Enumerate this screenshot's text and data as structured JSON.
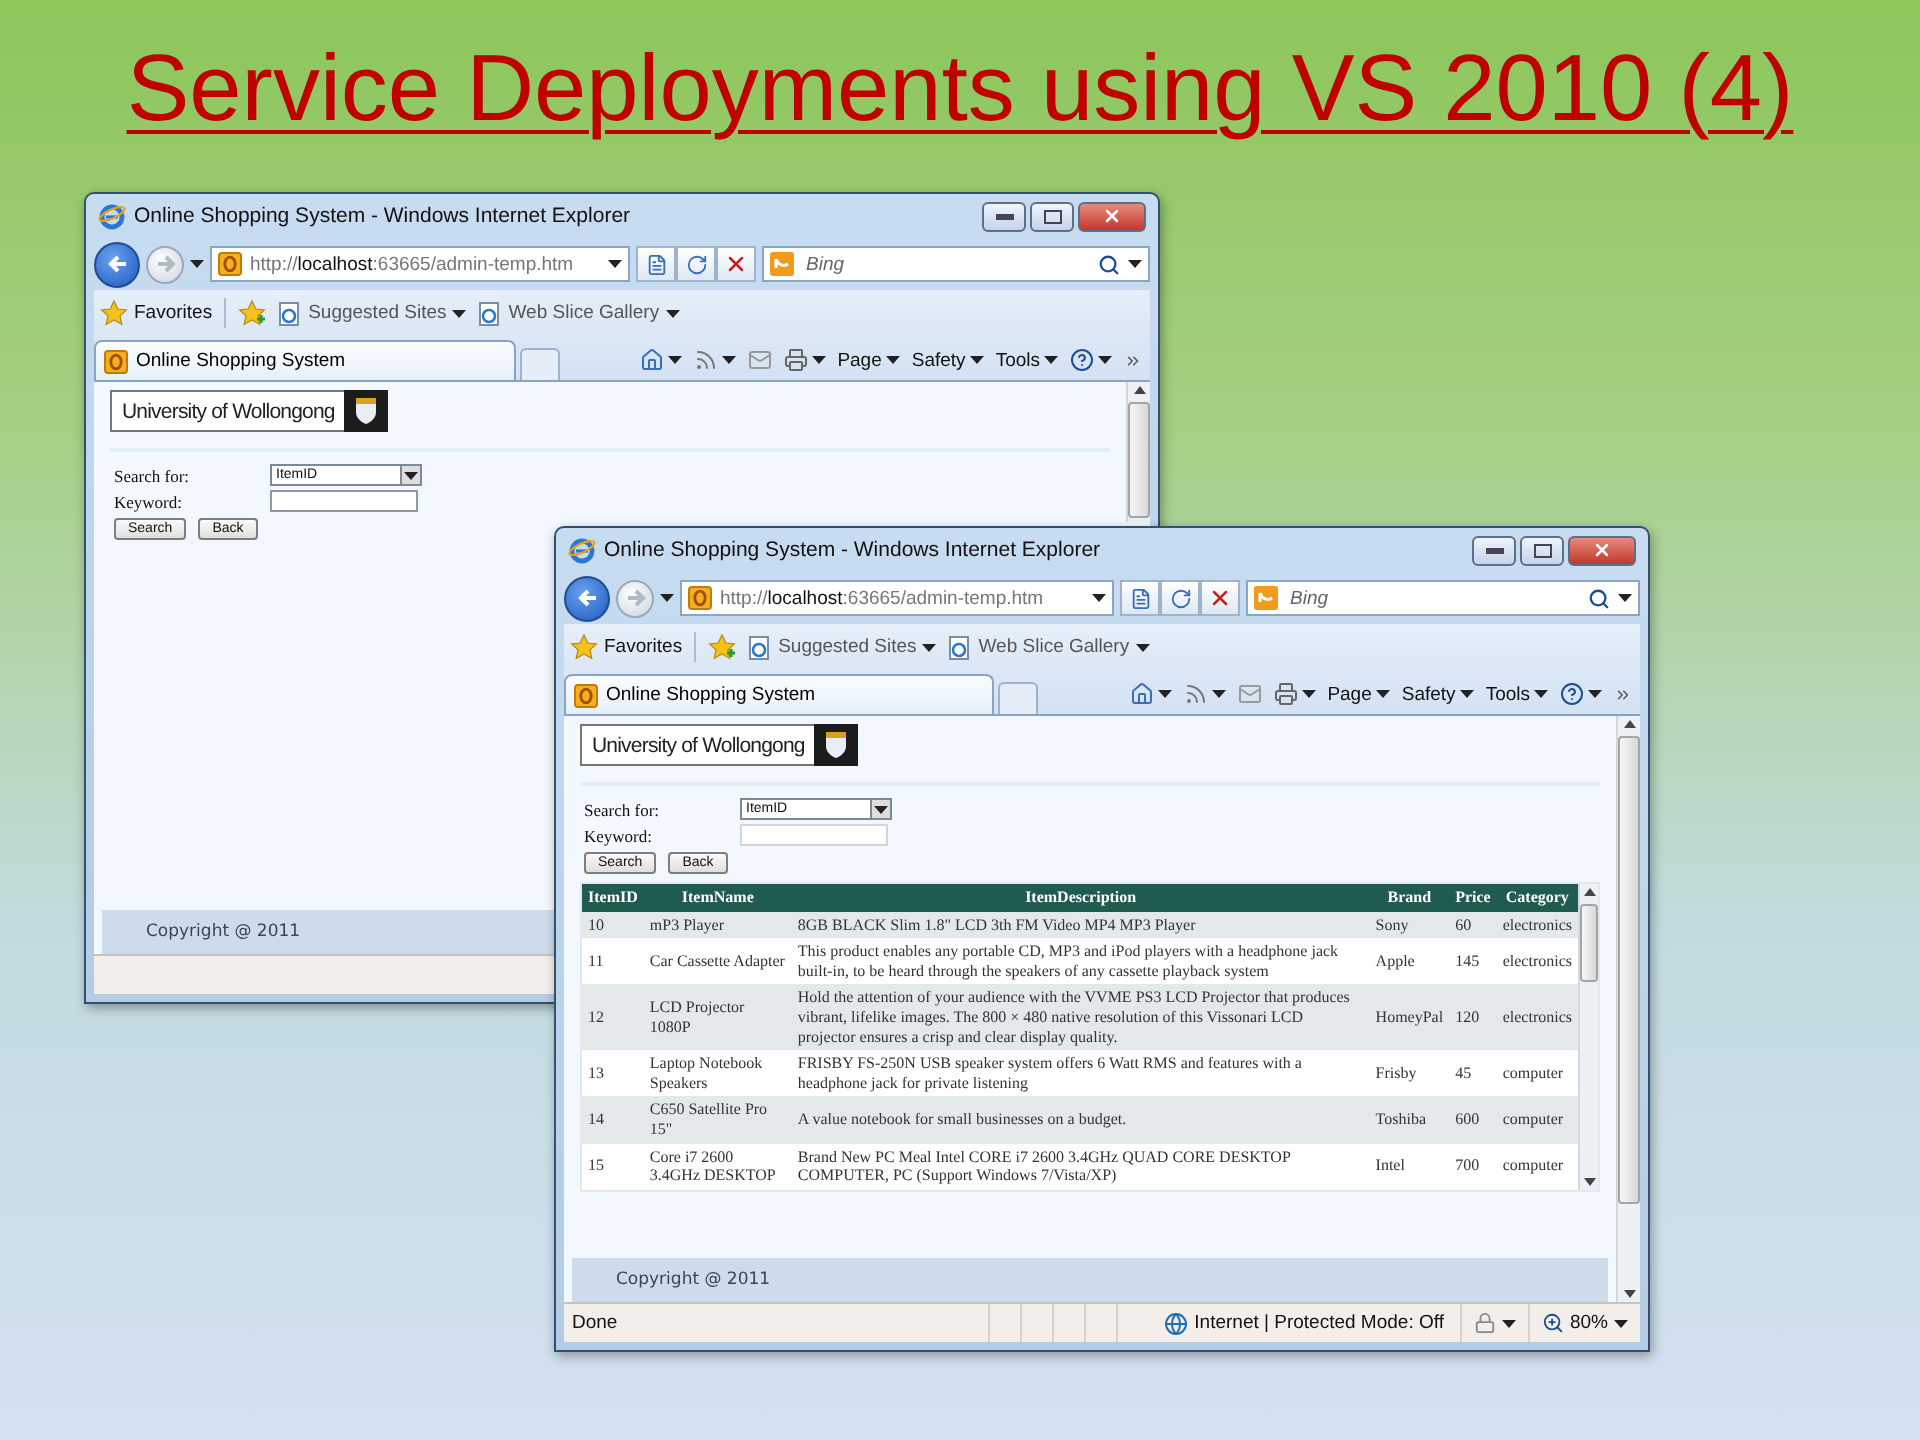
{
  "slide": {
    "title": "Service Deployments using VS 2010 (4)"
  },
  "windows": [
    {
      "title": "Online Shopping System - Windows Internet Explorer",
      "address": {
        "scheme": "http://",
        "host": "localhost",
        "rest": ":63665/admin-temp.htm"
      },
      "search": {
        "placeholder": "Bing"
      },
      "favorites_bar": {
        "favorites": "Favorites",
        "links": [
          "Suggested Sites",
          "Web Slice Gallery"
        ]
      },
      "tab": "Online Shopping System",
      "commands": [
        "Page",
        "Safety",
        "Tools"
      ],
      "page": {
        "header": "University of Wollongong",
        "form": {
          "search_label": "Search for:",
          "search_value": "ItemID",
          "keyword_label": "Keyword:",
          "buttons": [
            "Search",
            "Back"
          ]
        },
        "footer": "Copyright @ 2011"
      }
    },
    {
      "title": "Online Shopping System - Windows Internet Explorer",
      "address": {
        "scheme": "http://",
        "host": "localhost",
        "rest": ":63665/admin-temp.htm"
      },
      "search": {
        "placeholder": "Bing"
      },
      "favorites_bar": {
        "favorites": "Favorites",
        "links": [
          "Suggested Sites",
          "Web Slice Gallery"
        ]
      },
      "tab": "Online Shopping System",
      "commands": [
        "Page",
        "Safety",
        "Tools"
      ],
      "page": {
        "header": "University of Wollongong",
        "form": {
          "search_label": "Search for:",
          "search_value": "ItemID",
          "keyword_label": "Keyword:",
          "buttons": [
            "Search",
            "Back"
          ]
        },
        "table": {
          "columns": [
            "ItemID",
            "ItemName",
            "ItemDescription",
            "Brand",
            "Price",
            "Category"
          ],
          "rows": [
            [
              "10",
              "mP3 Player",
              "8GB BLACK Slim 1.8\" LCD 3th FM Video MP4 MP3 Player",
              "Sony",
              "60",
              "electronics"
            ],
            [
              "11",
              "Car Cassette Adapter",
              "This product enables any portable CD, MP3 and iPod players with a headphone jack built-in, to be heard through the speakers of any cassette playback system",
              "Apple",
              "145",
              "electronics"
            ],
            [
              "12",
              "LCD Projector 1080P",
              "Hold the attention of your audience with the VVME PS3 LCD Projector that produces vibrant, lifelike images. The 800 × 480 native resolution of this Vissonari LCD projector ensures a crisp and clear display quality.",
              "HomeyPal",
              "120",
              "electronics"
            ],
            [
              "13",
              "Laptop Notebook Speakers",
              "FRISBY FS-250N USB speaker system offers 6 Watt RMS and features with a headphone jack for private listening",
              "Frisby",
              "45",
              "computer"
            ],
            [
              "14",
              "C650 Satellite Pro 15\"",
              "A value notebook for small businesses on a budget.",
              "Toshiba",
              "600",
              "computer"
            ],
            [
              "15",
              "Core i7 2600 3.4GHz DESKTOP",
              "Brand New PC Meal Intel CORE i7 2600 3.4GHz QUAD CORE DESKTOP COMPUTER, PC (Support Windows 7/Vista/XP)",
              "Intel",
              "700",
              "computer"
            ]
          ]
        },
        "footer": "Copyright @ 2011"
      },
      "status_bar": {
        "text": "Done",
        "zone": "Internet | Protected Mode: Off",
        "zoom": "80%"
      }
    }
  ]
}
